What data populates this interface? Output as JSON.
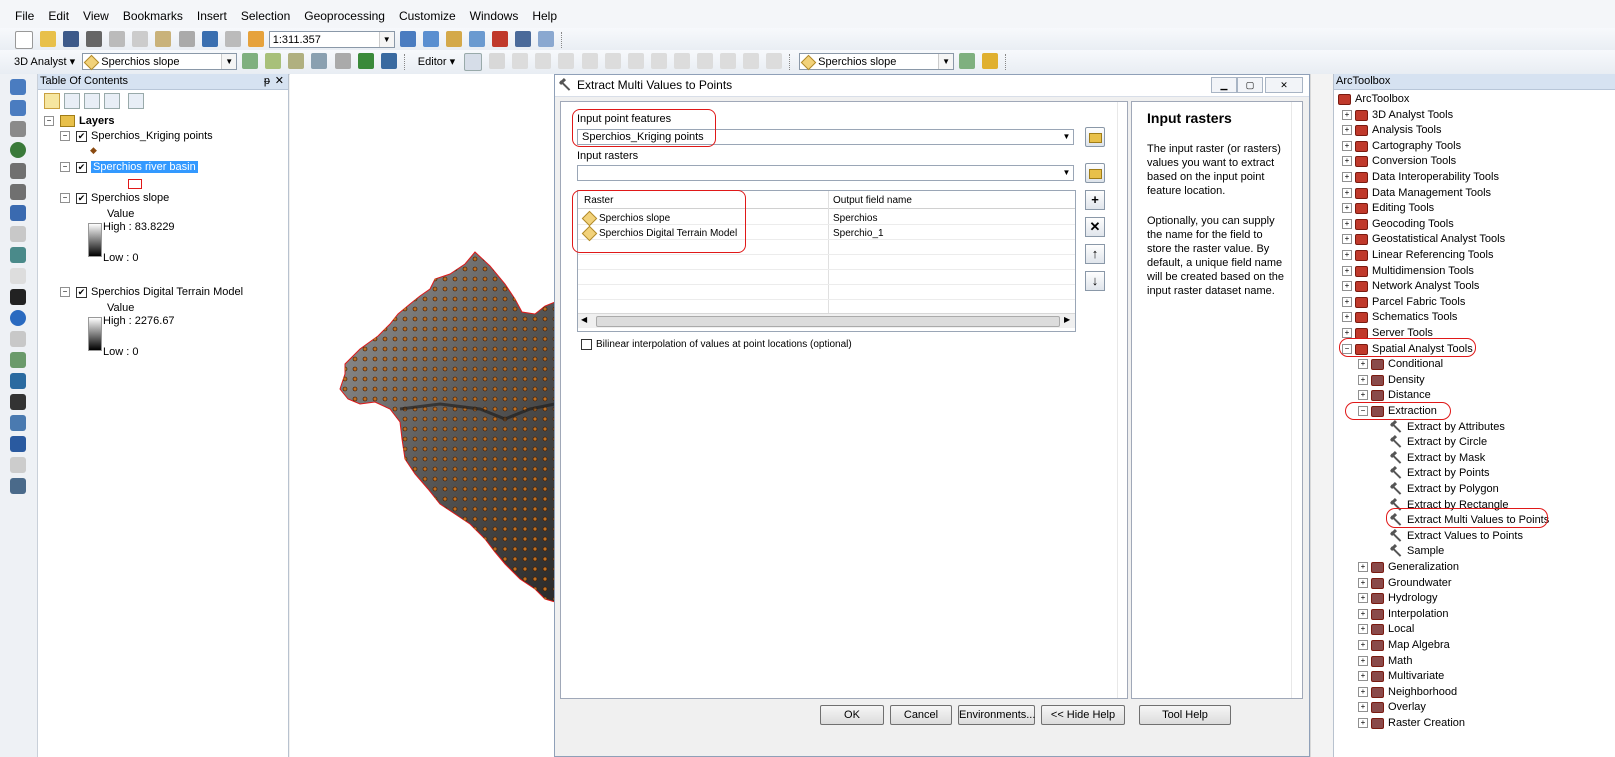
{
  "menu": [
    "File",
    "Edit",
    "View",
    "Bookmarks",
    "Insert",
    "Selection",
    "Geoprocessing",
    "Customize",
    "Windows",
    "Help"
  ],
  "toolbar1": {
    "scale": "1:311.357"
  },
  "toolbar2": {
    "analyst_label": "3D Analyst ▾",
    "layer_combo": "Sperchios slope",
    "editor_label": "Editor ▾",
    "layer_combo2": "Sperchios slope"
  },
  "toc": {
    "title": "Table Of Contents",
    "pin": "ᵽ",
    "close": "✕",
    "root": "Layers",
    "layers": [
      {
        "name": "Sperchios_Kriging points",
        "checked": "✔",
        "symbol": "◆"
      },
      {
        "name": "Sperchios river basin",
        "checked": "✔"
      },
      {
        "name": "Sperchios slope",
        "checked": "✔",
        "value_label": "Value",
        "high": "High : 83.8229",
        "low": "Low : 0"
      },
      {
        "name": "Sperchios Digital Terrain Model",
        "checked": "✔",
        "value_label": "Value",
        "high": "High : 2276.67",
        "low": "Low : 0"
      }
    ]
  },
  "dialog": {
    "title": "Extract Multi Values to Points",
    "input_point_label": "Input point features",
    "input_point_value": "Sperchios_Kriging points",
    "input_rasters_label": "Input rasters",
    "input_rasters_value": "",
    "table": {
      "headers": [
        "Raster",
        "Output field name"
      ],
      "rows": [
        {
          "raster": "Sperchios slope",
          "field": "Sperchios"
        },
        {
          "raster": "Sperchios Digital Terrain Model",
          "field": "Sperchio_1"
        }
      ]
    },
    "bilinear_label": "Bilinear interpolation of values at point locations (optional)",
    "buttons": {
      "ok": "OK",
      "cancel": "Cancel",
      "env": "Environments...",
      "hide": "<< Hide Help",
      "toolhelp": "Tool Help"
    },
    "help": {
      "title": "Input rasters",
      "p1": "The input raster (or rasters) values you want to extract based on the input point feature location.",
      "p2": "Optionally, you can supply the name for the field to store the raster value. By default, a unique field name will be created based on the input raster dataset name."
    }
  },
  "toolbox": {
    "title": "ArcToolbox",
    "root": "ArcToolbox",
    "toolsets": [
      "3D Analyst Tools",
      "Analysis Tools",
      "Cartography Tools",
      "Conversion Tools",
      "Data Interoperability Tools",
      "Data Management Tools",
      "Editing Tools",
      "Geocoding Tools",
      "Geostatistical Analyst Tools",
      "Linear Referencing Tools",
      "Multidimension Tools",
      "Network Analyst Tools",
      "Parcel Fabric Tools",
      "Schematics Tools",
      "Server Tools",
      "Spatial Analyst Tools"
    ],
    "spatial_children_before": [
      "Conditional",
      "Density",
      "Distance",
      "Extraction"
    ],
    "extraction_tools": [
      "Extract by Attributes",
      "Extract by Circle",
      "Extract by Mask",
      "Extract by Points",
      "Extract by Polygon",
      "Extract by Rectangle",
      "Extract Multi Values to Points",
      "Extract Values to Points",
      "Sample"
    ],
    "spatial_children_after": [
      "Generalization",
      "Groundwater",
      "Hydrology",
      "Interpolation",
      "Local",
      "Map Algebra",
      "Math",
      "Multivariate",
      "Neighborhood",
      "Overlay",
      "Raster Creation"
    ]
  }
}
